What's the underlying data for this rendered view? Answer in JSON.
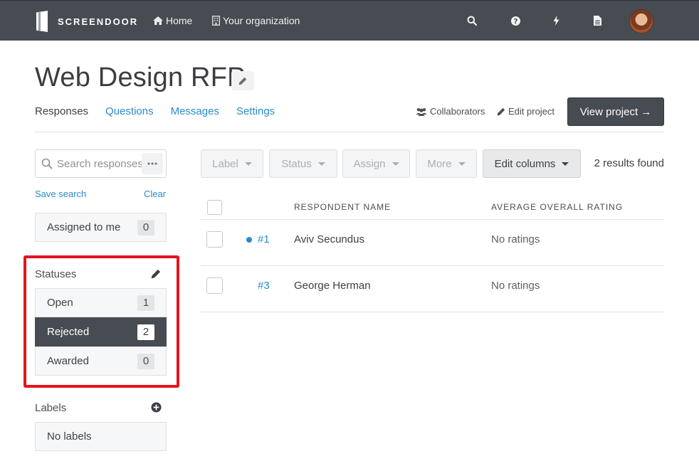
{
  "app": {
    "brand": "SCREENDOOR"
  },
  "topnav": {
    "home_label": "Home",
    "org_label": "Your organization",
    "icons": [
      "search-icon",
      "help-icon",
      "bolt-icon",
      "document-icon"
    ]
  },
  "project": {
    "title": "Web Design RFP",
    "tabs": [
      {
        "label": "Responses",
        "active": true
      },
      {
        "label": "Questions",
        "active": false
      },
      {
        "label": "Messages",
        "active": false
      },
      {
        "label": "Settings",
        "active": false
      }
    ],
    "collaborators_label": "Collaborators",
    "edit_project_label": "Edit project",
    "view_project_label": "View project →"
  },
  "sidebar": {
    "search_placeholder": "Search responses",
    "save_search_label": "Save search",
    "clear_label": "Clear",
    "assigned": {
      "label": "Assigned to me",
      "count": "0"
    },
    "statuses_title": "Statuses",
    "statuses": [
      {
        "label": "Open",
        "count": "1",
        "selected": false
      },
      {
        "label": "Rejected",
        "count": "2",
        "selected": true
      },
      {
        "label": "Awarded",
        "count": "0",
        "selected": false
      }
    ],
    "labels_title": "Labels",
    "no_labels": "No labels"
  },
  "toolbar": {
    "label_btn": "Label",
    "status_btn": "Status",
    "assign_btn": "Assign",
    "more_btn": "More",
    "edit_columns_btn": "Edit columns",
    "results_text": "2 results found"
  },
  "table": {
    "columns": [
      "RESPONDENT NAME",
      "AVERAGE OVERALL RATING"
    ],
    "rows": [
      {
        "id": "#1",
        "name": "Aviv Secundus",
        "rating": "No ratings",
        "unread": true
      },
      {
        "id": "#3",
        "name": "George Herman",
        "rating": "No ratings",
        "unread": false
      }
    ]
  },
  "colors": {
    "nav_bg": "#474b52",
    "link": "#2b8bcb",
    "highlight": "#e3141c",
    "selected_bg": "#474b52"
  }
}
